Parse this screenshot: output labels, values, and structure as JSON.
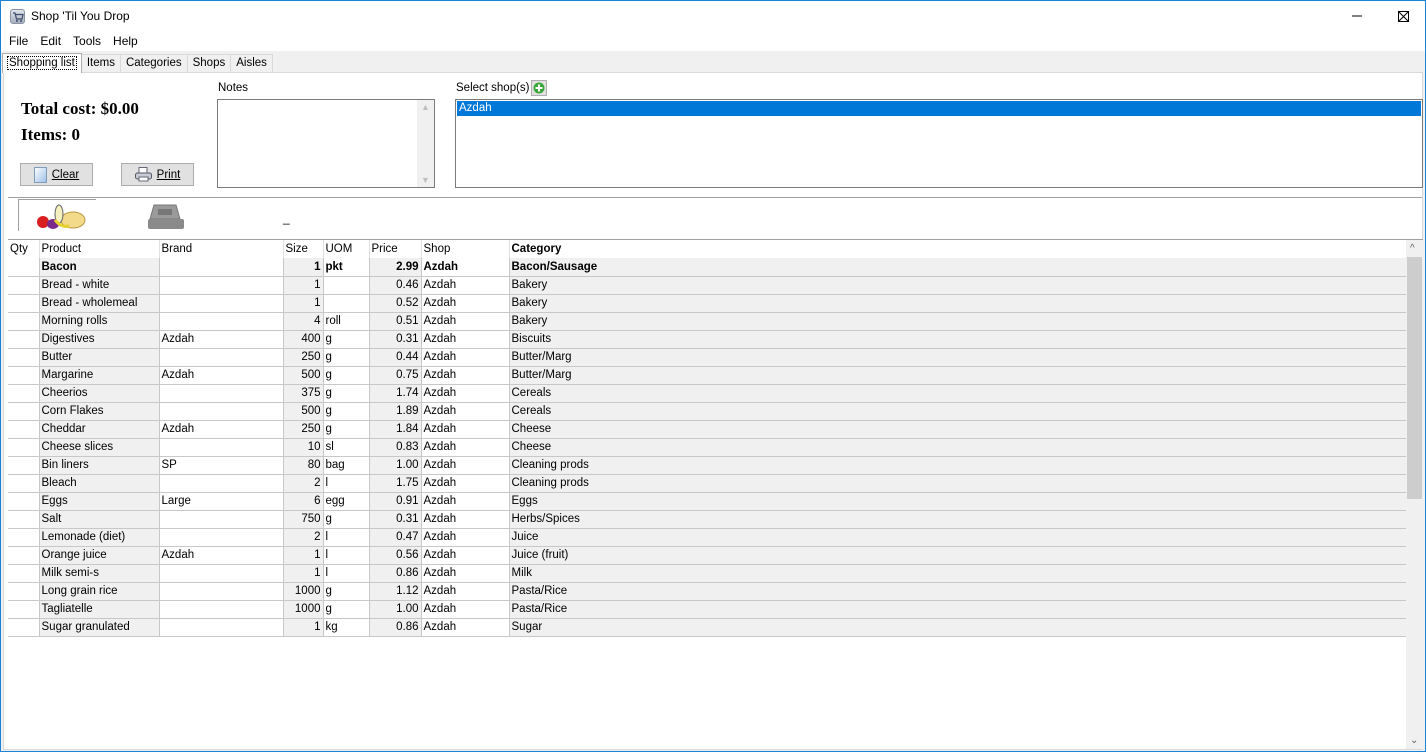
{
  "window": {
    "title": "Shop 'Til You Drop",
    "controls": [
      "minimize",
      "maximize",
      "close"
    ]
  },
  "menu": [
    "File",
    "Edit",
    "Tools",
    "Help"
  ],
  "tabs": [
    {
      "label": "Shopping list",
      "active": true
    },
    {
      "label": "Items",
      "active": false
    },
    {
      "label": "Categories",
      "active": false
    },
    {
      "label": "Shops",
      "active": false
    },
    {
      "label": "Aisles",
      "active": false
    }
  ],
  "summary": {
    "total_cost": "Total cost: $0.00",
    "items": "Items: 0"
  },
  "buttons": {
    "clear": "Clear",
    "print": "Print"
  },
  "notes": {
    "label": "Notes",
    "value": ""
  },
  "shops": {
    "label": "Select shop(s)",
    "options": [
      "Azdah"
    ],
    "selected": "Azdah"
  },
  "view_toggle": {
    "items_view_icon": "groceries-icon",
    "checkout_view_icon": "cash-register-icon",
    "status": "_"
  },
  "grid": {
    "columns": [
      "Qty",
      "Product",
      "Brand",
      "Size",
      "UOM",
      "Price",
      "Shop",
      "Category"
    ],
    "rows": [
      {
        "qty": "",
        "product": "Bacon",
        "brand": "",
        "size": "1",
        "uom": "pkt",
        "price": "2.99",
        "shop": "Azdah",
        "category": "Bacon/Sausage",
        "bold": true
      },
      {
        "qty": "",
        "product": "Bread - white",
        "brand": "",
        "size": "1",
        "uom": "",
        "price": "0.46",
        "shop": "Azdah",
        "category": "Bakery"
      },
      {
        "qty": "",
        "product": "Bread - wholemeal",
        "brand": "",
        "size": "1",
        "uom": "",
        "price": "0.52",
        "shop": "Azdah",
        "category": "Bakery"
      },
      {
        "qty": "",
        "product": "Morning rolls",
        "brand": "",
        "size": "4",
        "uom": "roll",
        "price": "0.51",
        "shop": "Azdah",
        "category": "Bakery"
      },
      {
        "qty": "",
        "product": "Digestives",
        "brand": "Azdah",
        "size": "400",
        "uom": "g",
        "price": "0.31",
        "shop": "Azdah",
        "category": "Biscuits"
      },
      {
        "qty": "",
        "product": "Butter",
        "brand": "",
        "size": "250",
        "uom": "g",
        "price": "0.44",
        "shop": "Azdah",
        "category": "Butter/Marg"
      },
      {
        "qty": "",
        "product": "Margarine",
        "brand": "Azdah",
        "size": "500",
        "uom": "g",
        "price": "0.75",
        "shop": "Azdah",
        "category": "Butter/Marg"
      },
      {
        "qty": "",
        "product": "Cheerios",
        "brand": "",
        "size": "375",
        "uom": "g",
        "price": "1.74",
        "shop": "Azdah",
        "category": "Cereals"
      },
      {
        "qty": "",
        "product": "Corn Flakes",
        "brand": "",
        "size": "500",
        "uom": "g",
        "price": "1.89",
        "shop": "Azdah",
        "category": "Cereals"
      },
      {
        "qty": "",
        "product": "Cheddar",
        "brand": "Azdah",
        "size": "250",
        "uom": "g",
        "price": "1.84",
        "shop": "Azdah",
        "category": "Cheese"
      },
      {
        "qty": "",
        "product": "Cheese slices",
        "brand": "",
        "size": "10",
        "uom": "sl",
        "price": "0.83",
        "shop": "Azdah",
        "category": "Cheese"
      },
      {
        "qty": "",
        "product": "Bin liners",
        "brand": "SP",
        "size": "80",
        "uom": "bag",
        "price": "1.00",
        "shop": "Azdah",
        "category": "Cleaning prods"
      },
      {
        "qty": "",
        "product": "Bleach",
        "brand": "",
        "size": "2",
        "uom": "l",
        "price": "1.75",
        "shop": "Azdah",
        "category": "Cleaning prods"
      },
      {
        "qty": "",
        "product": "Eggs",
        "brand": "Large",
        "size": "6",
        "uom": "egg",
        "price": "0.91",
        "shop": "Azdah",
        "category": "Eggs"
      },
      {
        "qty": "",
        "product": "Salt",
        "brand": "",
        "size": "750",
        "uom": "g",
        "price": "0.31",
        "shop": "Azdah",
        "category": "Herbs/Spices"
      },
      {
        "qty": "",
        "product": "Lemonade (diet)",
        "brand": "",
        "size": "2",
        "uom": "l",
        "price": "0.47",
        "shop": "Azdah",
        "category": "Juice"
      },
      {
        "qty": "",
        "product": "Orange juice",
        "brand": "Azdah",
        "size": "1",
        "uom": "l",
        "price": "0.56",
        "shop": "Azdah",
        "category": "Juice (fruit)"
      },
      {
        "qty": "",
        "product": "Milk semi-s",
        "brand": "",
        "size": "1",
        "uom": "l",
        "price": "0.86",
        "shop": "Azdah",
        "category": "Milk"
      },
      {
        "qty": "",
        "product": "Long grain rice",
        "brand": "",
        "size": "1000",
        "uom": "g",
        "price": "1.12",
        "shop": "Azdah",
        "category": "Pasta/Rice"
      },
      {
        "qty": "",
        "product": "Tagliatelle",
        "brand": "",
        "size": "1000",
        "uom": "g",
        "price": "1.00",
        "shop": "Azdah",
        "category": "Pasta/Rice"
      },
      {
        "qty": "",
        "product": "Sugar granulated",
        "brand": "",
        "size": "1",
        "uom": "kg",
        "price": "0.86",
        "shop": "Azdah",
        "category": "Sugar"
      }
    ]
  },
  "colors": {
    "selection": "#0078d7",
    "window_border": "#1883d7",
    "add_icon": "#3aa83a"
  }
}
